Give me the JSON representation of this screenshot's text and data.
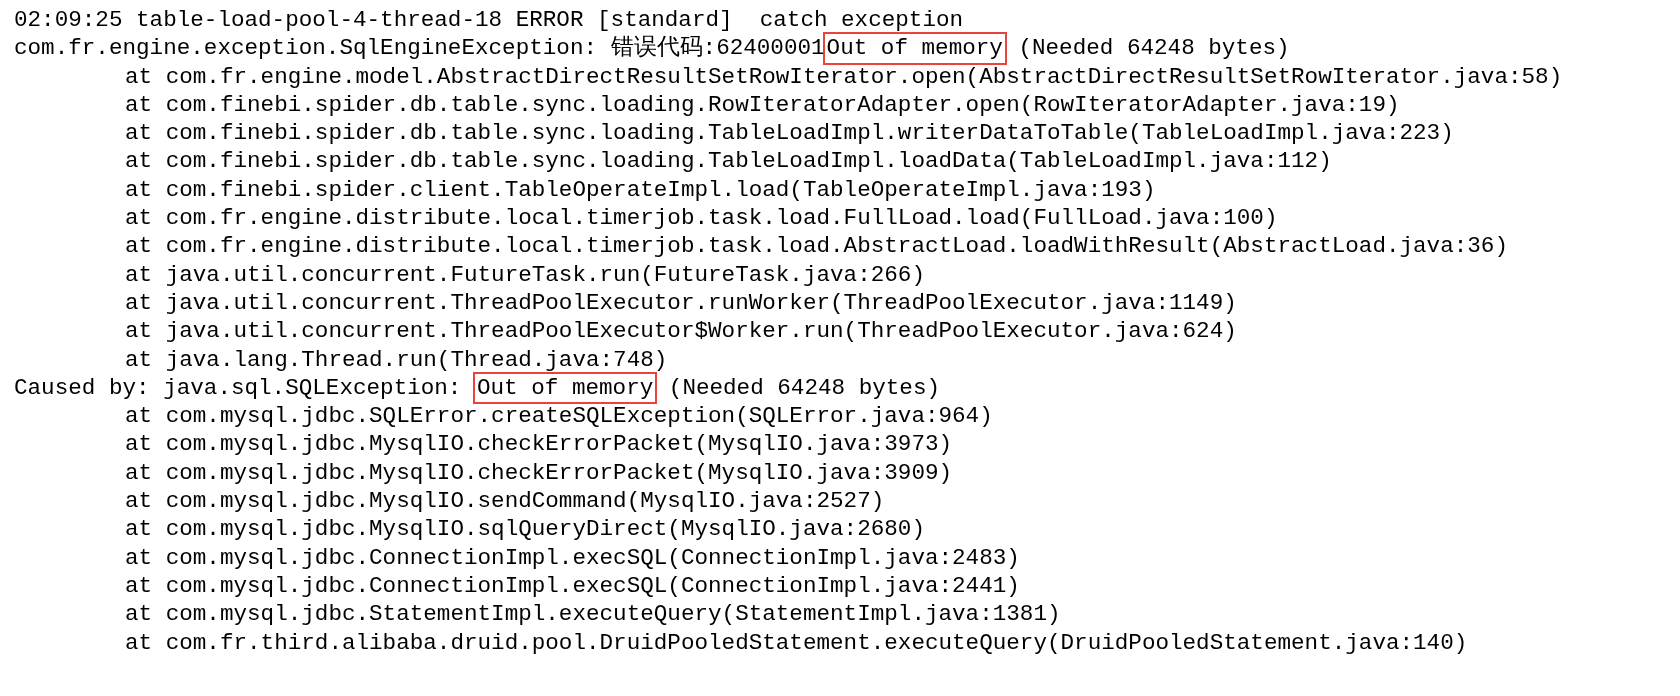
{
  "log_lines": [
    {
      "indented": false,
      "segments": [
        {
          "text": "02:09:25 table-load-pool-4-thread-18 ERROR [standard]  catch exception",
          "boxed": false
        }
      ]
    },
    {
      "indented": false,
      "segments": [
        {
          "text": "com.fr.engine.exception.SqlEngineException: 错误代码:62400001",
          "boxed": false
        },
        {
          "text": "Out of memory",
          "boxed": true
        },
        {
          "text": " (Needed 64248 bytes)",
          "boxed": false
        }
      ]
    },
    {
      "indented": true,
      "segments": [
        {
          "text": "at com.fr.engine.model.AbstractDirectResultSetRowIterator.open(AbstractDirectResultSetRowIterator.java:58)",
          "boxed": false
        }
      ]
    },
    {
      "indented": true,
      "segments": [
        {
          "text": "at com.finebi.spider.db.table.sync.loading.RowIteratorAdapter.open(RowIteratorAdapter.java:19)",
          "boxed": false
        }
      ]
    },
    {
      "indented": true,
      "segments": [
        {
          "text": "at com.finebi.spider.db.table.sync.loading.TableLoadImpl.writerDataToTable(TableLoadImpl.java:223)",
          "boxed": false
        }
      ]
    },
    {
      "indented": true,
      "segments": [
        {
          "text": "at com.finebi.spider.db.table.sync.loading.TableLoadImpl.loadData(TableLoadImpl.java:112)",
          "boxed": false
        }
      ]
    },
    {
      "indented": true,
      "segments": [
        {
          "text": "at com.finebi.spider.client.TableOperateImpl.load(TableOperateImpl.java:193)",
          "boxed": false
        }
      ]
    },
    {
      "indented": true,
      "segments": [
        {
          "text": "at com.fr.engine.distribute.local.timerjob.task.load.FullLoad.load(FullLoad.java:100)",
          "boxed": false
        }
      ]
    },
    {
      "indented": true,
      "segments": [
        {
          "text": "at com.fr.engine.distribute.local.timerjob.task.load.AbstractLoad.loadWithResult(AbstractLoad.java:36)",
          "boxed": false
        }
      ]
    },
    {
      "indented": true,
      "segments": [
        {
          "text": "at java.util.concurrent.FutureTask.run(FutureTask.java:266)",
          "boxed": false
        }
      ]
    },
    {
      "indented": true,
      "segments": [
        {
          "text": "at java.util.concurrent.ThreadPoolExecutor.runWorker(ThreadPoolExecutor.java:1149)",
          "boxed": false
        }
      ]
    },
    {
      "indented": true,
      "segments": [
        {
          "text": "at java.util.concurrent.ThreadPoolExecutor$Worker.run(ThreadPoolExecutor.java:624)",
          "boxed": false
        }
      ]
    },
    {
      "indented": true,
      "segments": [
        {
          "text": "at java.lang.Thread.run(Thread.java:748)",
          "boxed": false
        }
      ]
    },
    {
      "indented": false,
      "segments": [
        {
          "text": "Caused by: java.sql.SQLException: ",
          "boxed": false
        },
        {
          "text": "Out of memory",
          "boxed": true
        },
        {
          "text": " (Needed 64248 bytes)",
          "boxed": false
        }
      ]
    },
    {
      "indented": true,
      "segments": [
        {
          "text": "at com.mysql.jdbc.SQLError.createSQLException(SQLError.java:964)",
          "boxed": false
        }
      ]
    },
    {
      "indented": true,
      "segments": [
        {
          "text": "at com.mysql.jdbc.MysqlIO.checkErrorPacket(MysqlIO.java:3973)",
          "boxed": false
        }
      ]
    },
    {
      "indented": true,
      "segments": [
        {
          "text": "at com.mysql.jdbc.MysqlIO.checkErrorPacket(MysqlIO.java:3909)",
          "boxed": false
        }
      ]
    },
    {
      "indented": true,
      "segments": [
        {
          "text": "at com.mysql.jdbc.MysqlIO.sendCommand(MysqlIO.java:2527)",
          "boxed": false
        }
      ]
    },
    {
      "indented": true,
      "segments": [
        {
          "text": "at com.mysql.jdbc.MysqlIO.sqlQueryDirect(MysqlIO.java:2680)",
          "boxed": false
        }
      ]
    },
    {
      "indented": true,
      "segments": [
        {
          "text": "at com.mysql.jdbc.ConnectionImpl.execSQL(ConnectionImpl.java:2483)",
          "boxed": false
        }
      ]
    },
    {
      "indented": true,
      "segments": [
        {
          "text": "at com.mysql.jdbc.ConnectionImpl.execSQL(ConnectionImpl.java:2441)",
          "boxed": false
        }
      ]
    },
    {
      "indented": true,
      "segments": [
        {
          "text": "at com.mysql.jdbc.StatementImpl.executeQuery(StatementImpl.java:1381)",
          "boxed": false
        }
      ]
    },
    {
      "indented": true,
      "segments": [
        {
          "text": "at com.fr.third.alibaba.druid.pool.DruidPooledStatement.executeQuery(DruidPooledStatement.java:140)",
          "boxed": false
        }
      ]
    }
  ]
}
